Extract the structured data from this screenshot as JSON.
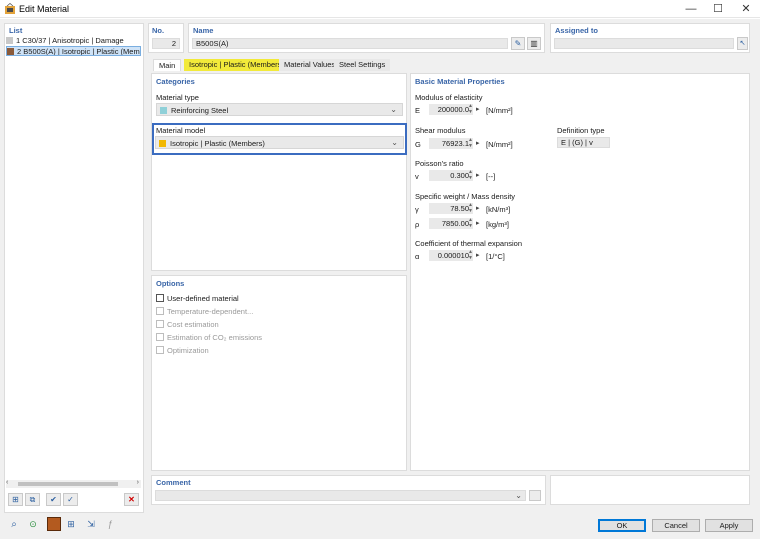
{
  "window": {
    "title": "Edit Material",
    "minimize": "—",
    "maximize": "☐",
    "close": "✕"
  },
  "list": {
    "header": "List",
    "items": [
      {
        "no": "1",
        "label": "C30/37 | Anisotropic | Damage",
        "color": "#c8c8c8"
      },
      {
        "no": "2",
        "label": "B500S(A) | Isotropic | Plastic (Members)",
        "color": "#8a5a3a"
      }
    ]
  },
  "header": {
    "no_label": "No.",
    "no_value": "2",
    "name_label": "Name",
    "name_value": "B500S(A)",
    "assigned_label": "Assigned to",
    "assigned_value": ""
  },
  "tabs": [
    {
      "label": "Main"
    },
    {
      "label": "Isotropic | Plastic (Members)"
    },
    {
      "label": "Material Values"
    },
    {
      "label": "Steel Settings"
    }
  ],
  "categories": {
    "header": "Categories",
    "material_type_label": "Material type",
    "material_type_value": "Reinforcing Steel",
    "material_type_color": "#8fd0d8",
    "material_model_label": "Material model",
    "material_model_value": "Isotropic | Plastic (Members)",
    "material_model_color": "#f2b800"
  },
  "options": {
    "header": "Options",
    "items": [
      {
        "label": "User-defined material",
        "enabled": true
      },
      {
        "label": "Temperature-dependent...",
        "enabled": false
      },
      {
        "label": "Cost estimation",
        "enabled": false
      },
      {
        "label": "Estimation of CO₂ emissions",
        "enabled": false
      },
      {
        "label": "Optimization",
        "enabled": false
      }
    ]
  },
  "basic": {
    "header": "Basic Material Properties",
    "modulus_label": "Modulus of elasticity",
    "E_sym": "E",
    "E_value": "200000.0",
    "E_unit": "[N/mm²]",
    "shear_label": "Shear modulus",
    "G_sym": "G",
    "G_value": "76923.1",
    "G_unit": "[N/mm²]",
    "def_type_label": "Definition type",
    "def_type_value": "E | (G) | v",
    "poisson_label": "Poisson's ratio",
    "v_sym": "v",
    "v_value": "0.300",
    "v_unit": "[--]",
    "weight_label": "Specific weight / Mass density",
    "gamma_sym": "γ",
    "gamma_value": "78.50",
    "gamma_unit": "[kN/m³]",
    "rho_sym": "ρ",
    "rho_value": "7850.00",
    "rho_unit": "[kg/m³]",
    "thermal_label": "Coefficient of thermal expansion",
    "alpha_sym": "α",
    "alpha_value": "0.000010",
    "alpha_unit": "[1/°C]"
  },
  "comment": {
    "label": "Comment",
    "value": ""
  },
  "buttons": {
    "ok": "OK",
    "cancel": "Cancel",
    "apply": "Apply"
  },
  "colors": {
    "accent": "#3a66a8",
    "tab_highlight": "#f2ea3a",
    "focus_border": "#3b6cc0"
  }
}
